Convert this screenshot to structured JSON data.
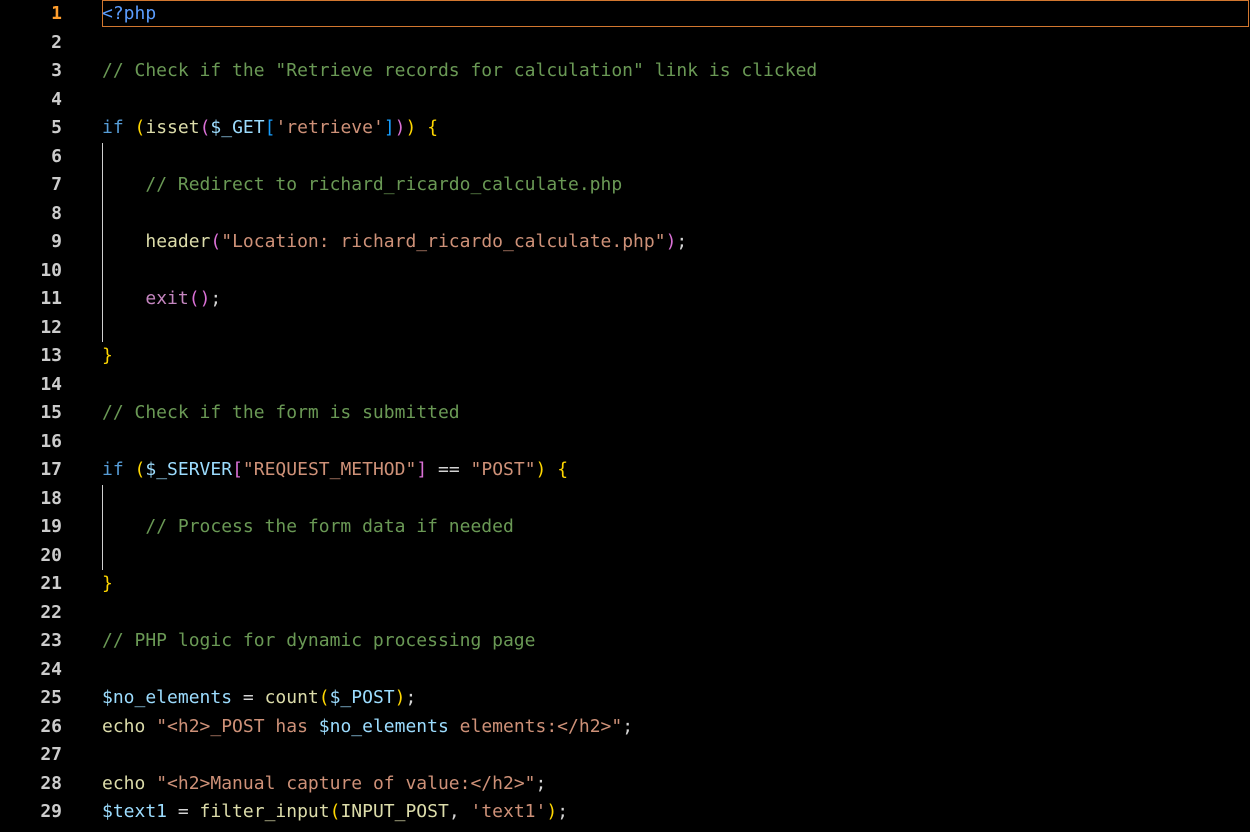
{
  "editor": {
    "active_line": 1,
    "language": "php",
    "line_numbers": [
      "1",
      "2",
      "3",
      "4",
      "5",
      "6",
      "7",
      "8",
      "9",
      "10",
      "11",
      "12",
      "13",
      "14",
      "15",
      "16",
      "17",
      "18",
      "19",
      "20",
      "21",
      "22",
      "23",
      "24",
      "25",
      "26",
      "27",
      "28",
      "29"
    ],
    "lines": [
      [
        {
          "t": "<?php",
          "c": "tag"
        }
      ],
      [],
      [
        {
          "t": "// Check if the \"Retrieve records for calculation\" link is clicked",
          "c": "cmt"
        }
      ],
      [],
      [
        {
          "t": "if",
          "c": "kw"
        },
        {
          "t": " ",
          "c": "def"
        },
        {
          "t": "(",
          "c": "p1"
        },
        {
          "t": "isset",
          "c": "fn"
        },
        {
          "t": "(",
          "c": "p2"
        },
        {
          "t": "$_GET",
          "c": "var"
        },
        {
          "t": "[",
          "c": "p3"
        },
        {
          "t": "'retrieve'",
          "c": "str"
        },
        {
          "t": "]",
          "c": "p3"
        },
        {
          "t": ")",
          "c": "p2"
        },
        {
          "t": ")",
          "c": "p1"
        },
        {
          "t": " ",
          "c": "def"
        },
        {
          "t": "{",
          "c": "p1"
        }
      ],
      [],
      [
        {
          "t": "    ",
          "c": "def"
        },
        {
          "t": "// Redirect to richard_ricardo_calculate.php",
          "c": "cmt"
        }
      ],
      [],
      [
        {
          "t": "    ",
          "c": "def"
        },
        {
          "t": "header",
          "c": "fn"
        },
        {
          "t": "(",
          "c": "p2"
        },
        {
          "t": "\"Location: richard_ricardo_calculate.php\"",
          "c": "str"
        },
        {
          "t": ")",
          "c": "p2"
        },
        {
          "t": ";",
          "c": "def"
        }
      ],
      [],
      [
        {
          "t": "    ",
          "c": "def"
        },
        {
          "t": "exit",
          "c": "ctl"
        },
        {
          "t": "(",
          "c": "p2"
        },
        {
          "t": ")",
          "c": "p2"
        },
        {
          "t": ";",
          "c": "def"
        }
      ],
      [],
      [
        {
          "t": "}",
          "c": "p1"
        }
      ],
      [],
      [
        {
          "t": "// Check if the form is submitted",
          "c": "cmt"
        }
      ],
      [],
      [
        {
          "t": "if",
          "c": "kw"
        },
        {
          "t": " ",
          "c": "def"
        },
        {
          "t": "(",
          "c": "p1"
        },
        {
          "t": "$_SERVER",
          "c": "var"
        },
        {
          "t": "[",
          "c": "p2"
        },
        {
          "t": "\"REQUEST_METHOD\"",
          "c": "str"
        },
        {
          "t": "]",
          "c": "p2"
        },
        {
          "t": " == ",
          "c": "def"
        },
        {
          "t": "\"POST\"",
          "c": "str"
        },
        {
          "t": ")",
          "c": "p1"
        },
        {
          "t": " ",
          "c": "def"
        },
        {
          "t": "{",
          "c": "p1"
        }
      ],
      [],
      [
        {
          "t": "    ",
          "c": "def"
        },
        {
          "t": "// Process the form data if needed",
          "c": "cmt"
        }
      ],
      [],
      [
        {
          "t": "}",
          "c": "p1"
        }
      ],
      [],
      [
        {
          "t": "// PHP logic for dynamic processing page",
          "c": "cmt"
        }
      ],
      [],
      [
        {
          "t": "$no_elements",
          "c": "var"
        },
        {
          "t": " = ",
          "c": "def"
        },
        {
          "t": "count",
          "c": "fn"
        },
        {
          "t": "(",
          "c": "p1"
        },
        {
          "t": "$_POST",
          "c": "var"
        },
        {
          "t": ")",
          "c": "p1"
        },
        {
          "t": ";",
          "c": "def"
        }
      ],
      [
        {
          "t": "echo",
          "c": "fn"
        },
        {
          "t": " ",
          "c": "def"
        },
        {
          "t": "\"<h2>_POST has ",
          "c": "str"
        },
        {
          "t": "$no_elements",
          "c": "var"
        },
        {
          "t": " elements:</h2>\"",
          "c": "str"
        },
        {
          "t": ";",
          "c": "def"
        }
      ],
      [],
      [
        {
          "t": "echo",
          "c": "fn"
        },
        {
          "t": " ",
          "c": "def"
        },
        {
          "t": "\"<h2>Manual capture of value:</h2>\"",
          "c": "str"
        },
        {
          "t": ";",
          "c": "def"
        }
      ],
      [
        {
          "t": "$text1",
          "c": "var"
        },
        {
          "t": " = ",
          "c": "def"
        },
        {
          "t": "filter_input",
          "c": "fn"
        },
        {
          "t": "(",
          "c": "p1"
        },
        {
          "t": "INPUT_POST",
          "c": "fn"
        },
        {
          "t": ", ",
          "c": "def"
        },
        {
          "t": "'text1'",
          "c": "str"
        },
        {
          "t": ")",
          "c": "p1"
        },
        {
          "t": ";",
          "c": "def"
        }
      ]
    ]
  }
}
